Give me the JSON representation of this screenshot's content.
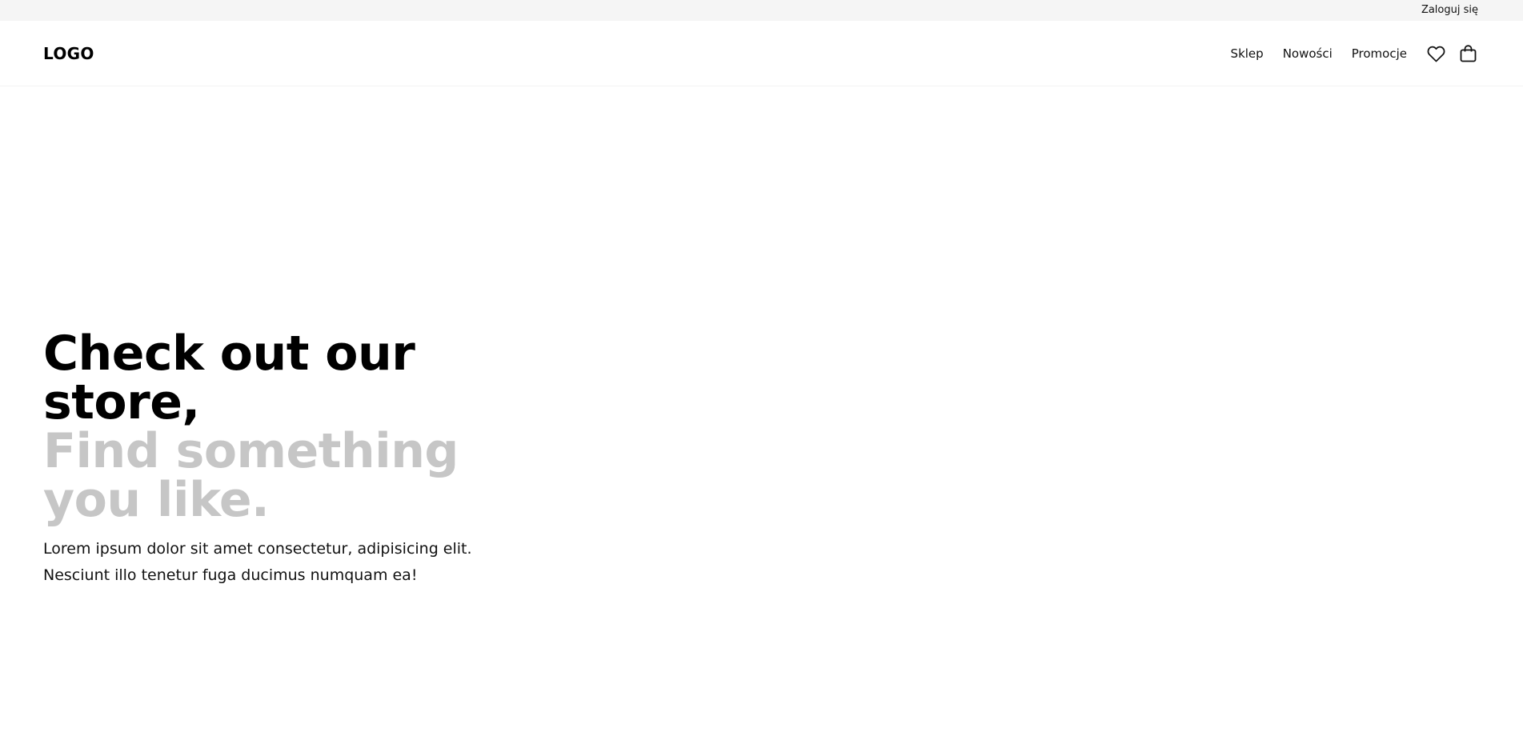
{
  "topbar": {
    "login_label": "Zaloguj się"
  },
  "header": {
    "logo": "LOGO",
    "nav": [
      {
        "label": "Sklep"
      },
      {
        "label": "Nowości"
      },
      {
        "label": "Promocje"
      }
    ],
    "icons": [
      "heart-icon",
      "shopping-bag-icon"
    ]
  },
  "hero": {
    "title": "Check out our store,",
    "subtitle": "Find something you like.",
    "description_line1": "Lorem ipsum dolor sit amet consectetur, adipisicing elit.",
    "description_line2": "Nesciunt illo tenetur fuga ducimus numquam ea!"
  },
  "colors": {
    "topbar_bg": "#f5f5f5",
    "title": "#000000",
    "subtitle": "#c6c6c6",
    "text": "#111111"
  }
}
